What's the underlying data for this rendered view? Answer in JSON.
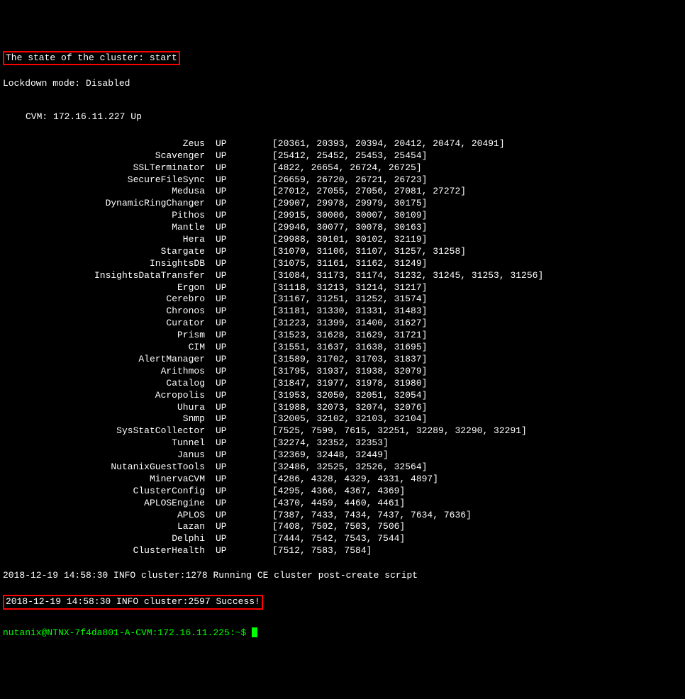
{
  "header": {
    "state_line": "The state of the cluster: start",
    "lockdown_line": "Lockdown mode: Disabled"
  },
  "cvm": {
    "label": "CVM:",
    "ip": "172.16.11.227",
    "status": "Up"
  },
  "services": [
    {
      "name": "Zeus",
      "status": "UP",
      "pids": "[20361, 20393, 20394, 20412, 20474, 20491]"
    },
    {
      "name": "Scavenger",
      "status": "UP",
      "pids": "[25412, 25452, 25453, 25454]"
    },
    {
      "name": "SSLTerminator",
      "status": "UP",
      "pids": "[4822, 26654, 26724, 26725]"
    },
    {
      "name": "SecureFileSync",
      "status": "UP",
      "pids": "[26659, 26720, 26721, 26723]"
    },
    {
      "name": "Medusa",
      "status": "UP",
      "pids": "[27012, 27055, 27056, 27081, 27272]"
    },
    {
      "name": "DynamicRingChanger",
      "status": "UP",
      "pids": "[29907, 29978, 29979, 30175]"
    },
    {
      "name": "Pithos",
      "status": "UP",
      "pids": "[29915, 30006, 30007, 30109]"
    },
    {
      "name": "Mantle",
      "status": "UP",
      "pids": "[29946, 30077, 30078, 30163]"
    },
    {
      "name": "Hera",
      "status": "UP",
      "pids": "[29988, 30101, 30102, 32119]"
    },
    {
      "name": "Stargate",
      "status": "UP",
      "pids": "[31070, 31106, 31107, 31257, 31258]"
    },
    {
      "name": "InsightsDB",
      "status": "UP",
      "pids": "[31075, 31161, 31162, 31249]"
    },
    {
      "name": "InsightsDataTransfer",
      "status": "UP",
      "pids": "[31084, 31173, 31174, 31232, 31245, 31253, 31256]"
    },
    {
      "name": "Ergon",
      "status": "UP",
      "pids": "[31118, 31213, 31214, 31217]"
    },
    {
      "name": "Cerebro",
      "status": "UP",
      "pids": "[31167, 31251, 31252, 31574]"
    },
    {
      "name": "Chronos",
      "status": "UP",
      "pids": "[31181, 31330, 31331, 31483]"
    },
    {
      "name": "Curator",
      "status": "UP",
      "pids": "[31223, 31399, 31400, 31627]"
    },
    {
      "name": "Prism",
      "status": "UP",
      "pids": "[31523, 31628, 31629, 31721]"
    },
    {
      "name": "CIM",
      "status": "UP",
      "pids": "[31551, 31637, 31638, 31695]"
    },
    {
      "name": "AlertManager",
      "status": "UP",
      "pids": "[31589, 31702, 31703, 31837]"
    },
    {
      "name": "Arithmos",
      "status": "UP",
      "pids": "[31795, 31937, 31938, 32079]"
    },
    {
      "name": "Catalog",
      "status": "UP",
      "pids": "[31847, 31977, 31978, 31980]"
    },
    {
      "name": "Acropolis",
      "status": "UP",
      "pids": "[31953, 32050, 32051, 32054]"
    },
    {
      "name": "Uhura",
      "status": "UP",
      "pids": "[31988, 32073, 32074, 32076]"
    },
    {
      "name": "Snmp",
      "status": "UP",
      "pids": "[32005, 32102, 32103, 32104]"
    },
    {
      "name": "SysStatCollector",
      "status": "UP",
      "pids": "[7525, 7599, 7615, 32251, 32289, 32290, 32291]"
    },
    {
      "name": "Tunnel",
      "status": "UP",
      "pids": "[32274, 32352, 32353]"
    },
    {
      "name": "Janus",
      "status": "UP",
      "pids": "[32369, 32448, 32449]"
    },
    {
      "name": "NutanixGuestTools",
      "status": "UP",
      "pids": "[32486, 32525, 32526, 32564]"
    },
    {
      "name": "MinervaCVM",
      "status": "UP",
      "pids": "[4286, 4328, 4329, 4331, 4897]"
    },
    {
      "name": "ClusterConfig",
      "status": "UP",
      "pids": "[4295, 4366, 4367, 4369]"
    },
    {
      "name": "APLOSEngine",
      "status": "UP",
      "pids": "[4370, 4459, 4460, 4461]"
    },
    {
      "name": "APLOS",
      "status": "UP",
      "pids": "[7387, 7433, 7434, 7437, 7634, 7636]"
    },
    {
      "name": "Lazan",
      "status": "UP",
      "pids": "[7408, 7502, 7503, 7506]"
    },
    {
      "name": "Delphi",
      "status": "UP",
      "pids": "[7444, 7542, 7543, 7544]"
    },
    {
      "name": "ClusterHealth",
      "status": "UP",
      "pids": "[7512, 7583, 7584]"
    }
  ],
  "logs": {
    "line1": "2018-12-19 14:58:30 INFO cluster:1278 Running CE cluster post-create script",
    "line2": "2018-12-19 14:58:30 INFO cluster:2597 Success!"
  },
  "prompt": {
    "text": "nutanix@NTNX-7f4da801-A-CVM:172.16.11.225:~$ "
  }
}
